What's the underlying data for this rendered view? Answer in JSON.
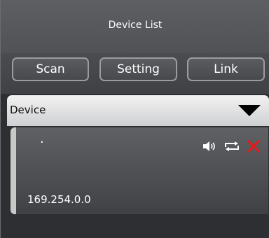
{
  "header": {
    "title": "Device List"
  },
  "toolbar": {
    "scan_label": "Scan",
    "setting_label": "Setting",
    "link_label": "Link"
  },
  "device_select": {
    "selected": "Device"
  },
  "devices": [
    {
      "name": ".",
      "ip": "169.254.0.0",
      "icons": [
        "speaker-icon",
        "repeat-icon",
        "delete-icon"
      ]
    }
  ],
  "colors": {
    "background": "#2d2f33",
    "delete": "#e21b1b"
  }
}
